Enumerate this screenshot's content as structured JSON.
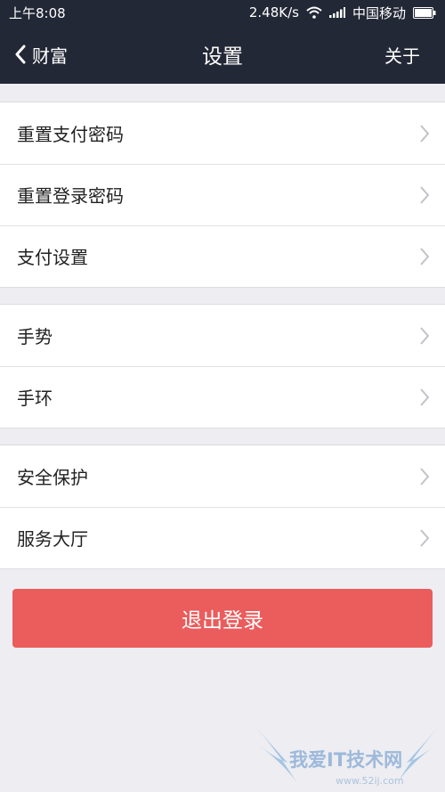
{
  "statusbar": {
    "time": "上午8:08",
    "speed": "2.48K/s",
    "carrier": "中国移动",
    "icons": [
      "wifi-icon",
      "signal-icon",
      "battery-icon"
    ]
  },
  "navbar": {
    "back_label": "财富",
    "title": "设置",
    "about_label": "关于"
  },
  "groups": [
    {
      "items": [
        {
          "label": "重置支付密码"
        },
        {
          "label": "重置登录密码"
        },
        {
          "label": "支付设置"
        }
      ]
    },
    {
      "items": [
        {
          "label": "手势"
        },
        {
          "label": "手环"
        }
      ]
    },
    {
      "items": [
        {
          "label": "安全保护"
        },
        {
          "label": "服务大厅"
        }
      ]
    }
  ],
  "logout_label": "退出登录",
  "watermark": {
    "text": "我爱IT技术网",
    "url": "www.52ij.com"
  },
  "colors": {
    "header_bg": "#232836",
    "page_bg": "#ededf2",
    "logout_bg": "#eb5c5c",
    "chevron": "#c2c2c8"
  }
}
